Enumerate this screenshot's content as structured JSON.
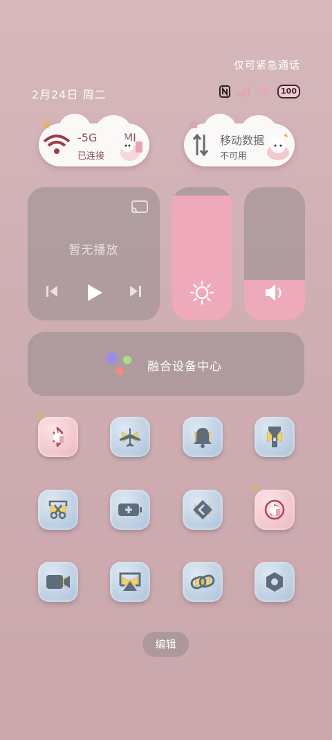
{
  "status_bar": {
    "emergency_text": "仅可紧急通话",
    "date_text": "2月24日 周二",
    "battery_text": "100"
  },
  "connectivity": {
    "wifi_tile": {
      "title": "-5G",
      "title_suffix": "MI",
      "subtitle": "已连接",
      "active": true
    },
    "data_tile": {
      "title": "移动数据",
      "subtitle": "不可用",
      "active": false
    }
  },
  "media": {
    "title": "暂无播放"
  },
  "sliders": {
    "brightness_level": 0.94,
    "volume_level": 0.3
  },
  "device_hub": {
    "label": "融合设备中心"
  },
  "toggles": [
    {
      "icon": "bluetooth-icon",
      "active": true
    },
    {
      "icon": "airplane-icon",
      "active": false
    },
    {
      "icon": "bell-icon",
      "active": false
    },
    {
      "icon": "flashlight-icon",
      "active": false
    },
    {
      "icon": "screenshot-icon",
      "active": false
    },
    {
      "icon": "battery-saver-icon",
      "active": false
    },
    {
      "icon": "nfc-share-icon",
      "active": false
    },
    {
      "icon": "rotation-lock-icon",
      "active": true
    },
    {
      "icon": "screen-record-icon",
      "active": false
    },
    {
      "icon": "screen-cast-icon",
      "active": false
    },
    {
      "icon": "link-icon",
      "active": false
    },
    {
      "icon": "settings-icon",
      "active": false
    }
  ],
  "footer": {
    "edit_label": "编辑"
  },
  "colors": {
    "accent_pink": "#eeaabb",
    "active_text": "#8d4f5a",
    "icon_gray": "#5f6c7a"
  }
}
